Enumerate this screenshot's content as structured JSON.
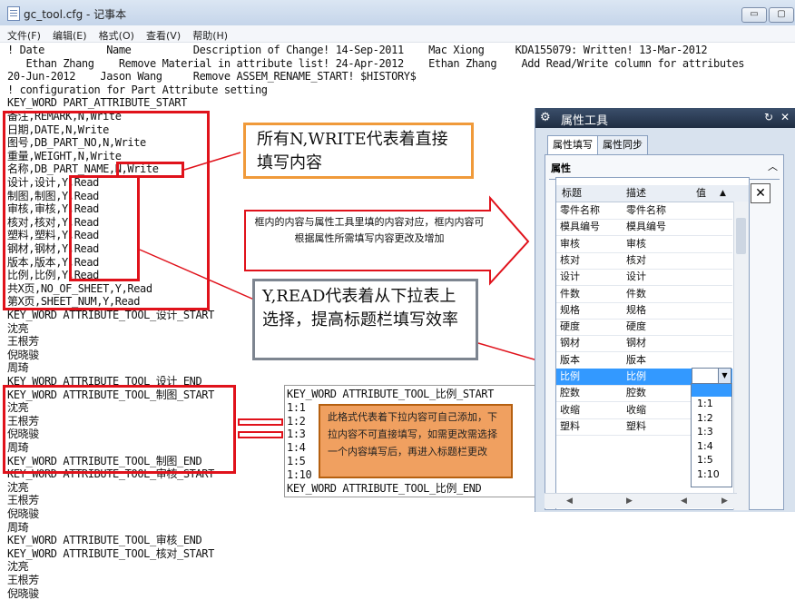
{
  "window": {
    "title": "gc_tool.cfg - 记事本",
    "min_label": "▭",
    "max_label": "▢"
  },
  "menu": [
    "文件(F)",
    "编辑(E)",
    "格式(O)",
    "查看(V)",
    "帮助(H)"
  ],
  "lines": [
    "! Date          Name          Description of Change! 14-Sep-2011    Mac Xiong     KDA155079: Written! 13-Mar-2012",
    "   Ethan Zhang    Remove Material in attribute list! 24-Apr-2012    Ethan Zhang    Add Read/Write column for attributes",
    "20-Jun-2012    Jason Wang     Remove ASSEM_RENAME_START! $HISTORY$",
    "! configuration for Part Attribute setting",
    "KEY_WORD PART_ATTRIBUTE_START",
    "备注,REMARK,N,Write",
    "日期,DATE,N,Write",
    "图号,DB_PART_NO,N,Write",
    "重量,WEIGHT,N,Write",
    "名称,DB_PART_NAME,N,Write",
    "设计,设计,Y,Read",
    "制图,制图,Y,Read",
    "审核,审核,Y,Read",
    "核对,核对,Y,Read",
    "塑料,塑料,Y,Read",
    "钢材,钢材,Y,Read",
    "版本,版本,Y,Read",
    "比例,比例,Y,Read",
    "共X页,NO_OF_SHEET,Y,Read",
    "第X页,SHEET_NUM,Y,Read",
    "KEY_WORD ATTRIBUTE_TOOL_设计_START",
    "沈亮",
    "王根芳",
    "倪晓骏",
    "周琦",
    "KEY_WORD ATTRIBUTE_TOOL_设计_END",
    "KEY_WORD ATTRIBUTE_TOOL_制图_START",
    "沈亮",
    "王根芳",
    "倪晓骏",
    "周琦",
    "KEY_WORD ATTRIBUTE_TOOL_制图_END",
    "KEY_WORD ATTRIBUTE_TOOL_审核_START",
    "沈亮",
    "王根芳",
    "倪晓骏",
    "周琦",
    "KEY_WORD ATTRIBUTE_TOOL_审核_END",
    "KEY_WORD ATTRIBUTE_TOOL_核对_START",
    "沈亮",
    "王根芳",
    "倪晓骏"
  ],
  "callouts": {
    "nwrite": "所有N,WRITE代表着直接填写内容",
    "box_note": "框内的内容与属性工具里填的内容对应，框内内容可根据属性所需填写内容更改及增加",
    "yread": "Y,READ代表着从下拉表上选择，提高标题栏填写效率",
    "format_note": "此格式代表着下拉内容可自己添加，下拉内容不可直接填写，如需更改需选择一个内容填写后，再进入标题栏更改"
  },
  "example": {
    "lines": [
      "KEY_WORD ATTRIBUTE_TOOL_比例_START",
      "1:1",
      "1:2",
      "1:3",
      "1:4",
      "1:5",
      "1:10",
      "KEY_WORD ATTRIBUTE_TOOL_比例_END"
    ]
  },
  "panel": {
    "title": "属性工具",
    "tabs": [
      "属性填写",
      "属性同步"
    ],
    "section": "属性",
    "columns": [
      "标题",
      "描述",
      "值"
    ],
    "rows": [
      [
        "零件名称",
        "零件名称"
      ],
      [
        "模具编号",
        "模具编号"
      ],
      [
        "审核",
        "审核"
      ],
      [
        "核对",
        "核对"
      ],
      [
        "设计",
        "设计"
      ],
      [
        "件数",
        "件数"
      ],
      [
        "规格",
        "规格"
      ],
      [
        "硬度",
        "硬度"
      ],
      [
        "钢材",
        "钢材"
      ],
      [
        "版本",
        "版本"
      ],
      [
        "比例",
        "比例"
      ],
      [
        "腔数",
        "腔数"
      ],
      [
        "收缩",
        "收缩"
      ],
      [
        "塑料",
        "塑料"
      ]
    ],
    "dropdown": [
      "1:1",
      "1:2",
      "1:3",
      "1:4",
      "1:5",
      "1:10"
    ]
  }
}
